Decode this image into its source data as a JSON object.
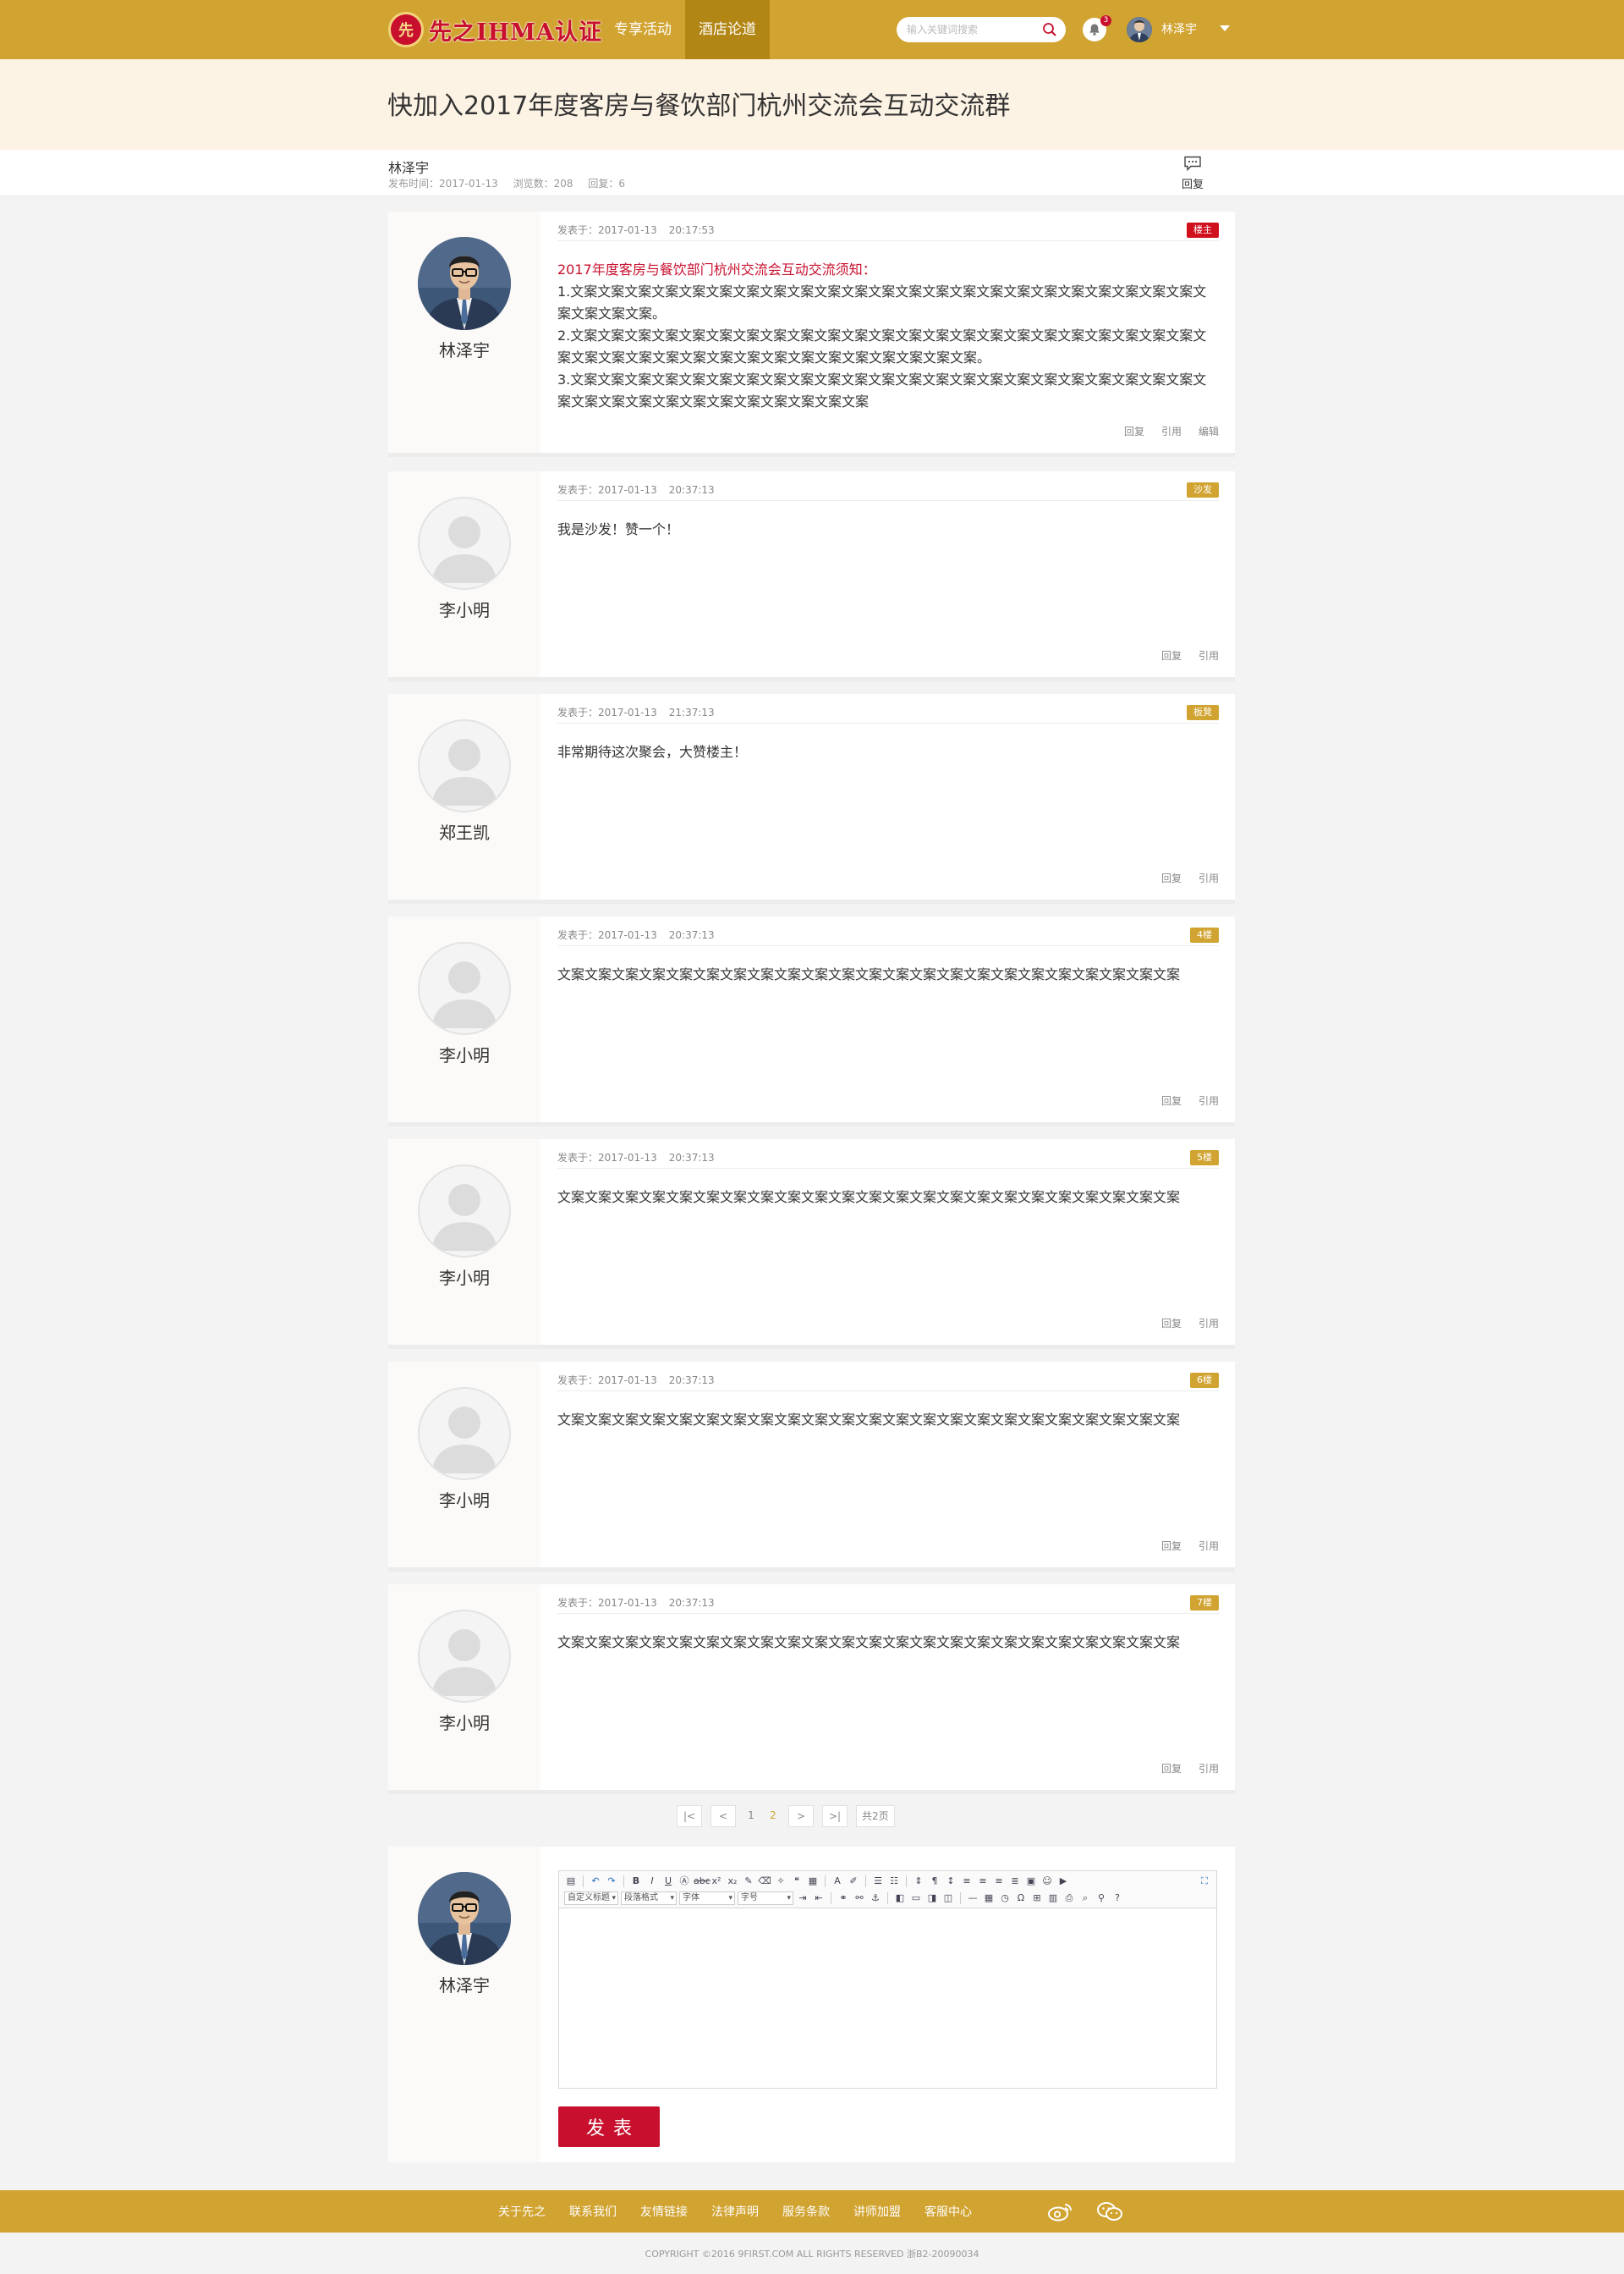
{
  "header": {
    "logo_text": "先之IHMA认证",
    "logo_seal": "先",
    "nav": [
      {
        "label": "专享活动",
        "active": false
      },
      {
        "label": "酒店论道",
        "active": true
      }
    ],
    "search_placeholder": "输入关键词搜索",
    "notification_count": "3",
    "user_name": "林泽宇"
  },
  "thread": {
    "title": "快加入2017年度客房与餐饮部门杭州交流会互动交流群",
    "author": "林泽宇",
    "published": "发布时间：2017-01-13",
    "views": "浏览数：208",
    "replies": "回复：6",
    "reply_label": "回复"
  },
  "posts": [
    {
      "name": "林泽宇",
      "date": "发表于：2017-01-13",
      "time": "20:17:53",
      "badge": "楼主",
      "lead": "2017年度客房与餐饮部门杭州交流会互动交流须知：",
      "lines": [
        "1.文案文案文案文案文案文案文案文案文案文案文案文案文案文案文案文案文案文案文案文案文案文案文案文案文案文案文案。",
        "2.文案文案文案文案文案文案文案文案文案文案文案文案文案文案文案文案文案文案文案文案文案文案文案文案文案文案文案文案文案文案文案文案文案文案文案文案文案文案文案。",
        "3.文案文案文案文案文案文案文案文案文案文案文案文案文案文案文案文案文案文案文案文案文案文案文案文案文案文案文案文案文案文案文案文案文案文案文案"
      ],
      "actions": [
        "回复",
        "引用",
        "编辑"
      ]
    },
    {
      "name": "李小明",
      "date": "发表于：2017-01-13",
      "time": "20:37:13",
      "badge": "沙发",
      "text": "我是沙发！赞一个！",
      "actions": [
        "回复",
        "引用"
      ]
    },
    {
      "name": "郑王凯",
      "date": "发表于：2017-01-13",
      "time": "21:37:13",
      "badge": "板凳",
      "text": "非常期待这次聚会，大赞楼主！",
      "actions": [
        "回复",
        "引用"
      ]
    },
    {
      "name": "李小明",
      "date": "发表于：2017-01-13",
      "time": "20:37:13",
      "badge": "4楼",
      "text": "文案文案文案文案文案文案文案文案文案文案文案文案文案文案文案文案文案文案文案文案文案文案文案",
      "actions": [
        "回复",
        "引用"
      ]
    },
    {
      "name": "李小明",
      "date": "发表于：2017-01-13",
      "time": "20:37:13",
      "badge": "5楼",
      "text": "文案文案文案文案文案文案文案文案文案文案文案文案文案文案文案文案文案文案文案文案文案文案文案",
      "actions": [
        "回复",
        "引用"
      ]
    },
    {
      "name": "李小明",
      "date": "发表于：2017-01-13",
      "time": "20:37:13",
      "badge": "6楼",
      "text": "文案文案文案文案文案文案文案文案文案文案文案文案文案文案文案文案文案文案文案文案文案文案文案",
      "actions": [
        "回复",
        "引用"
      ]
    },
    {
      "name": "李小明",
      "date": "发表于：2017-01-13",
      "time": "20:37:13",
      "badge": "7楼",
      "text": "文案文案文案文案文案文案文案文案文案文案文案文案文案文案文案文案文案文案文案文案文案文案文案",
      "actions": [
        "回复",
        "引用"
      ]
    }
  ],
  "pagination": {
    "first": "|<",
    "prev": "<",
    "pages": [
      "1",
      "2"
    ],
    "current": "2",
    "next": ">",
    "last": ">|",
    "total": "共2页"
  },
  "composer": {
    "name": "林泽宇",
    "selects": [
      "自定义标题",
      "段落格式",
      "字体",
      "字号"
    ],
    "submit_label": "发表"
  },
  "footer": {
    "links": [
      "关于先之",
      "联系我们",
      "友情链接",
      "法律声明",
      "服务条款",
      "讲师加盟",
      "客服中心"
    ],
    "social_icons": [
      "weibo-icon",
      "wechat-icon"
    ],
    "copyright": "COPYRIGHT ©2016 9FIRST.COM ALL RIGHTS RESERVED    浙B2-20090034"
  },
  "colors": {
    "brand_gold": "#d1a330",
    "brand_gold_dark": "#b28614",
    "brand_red": "#c8102e",
    "title_band": "#fdf3e4"
  }
}
